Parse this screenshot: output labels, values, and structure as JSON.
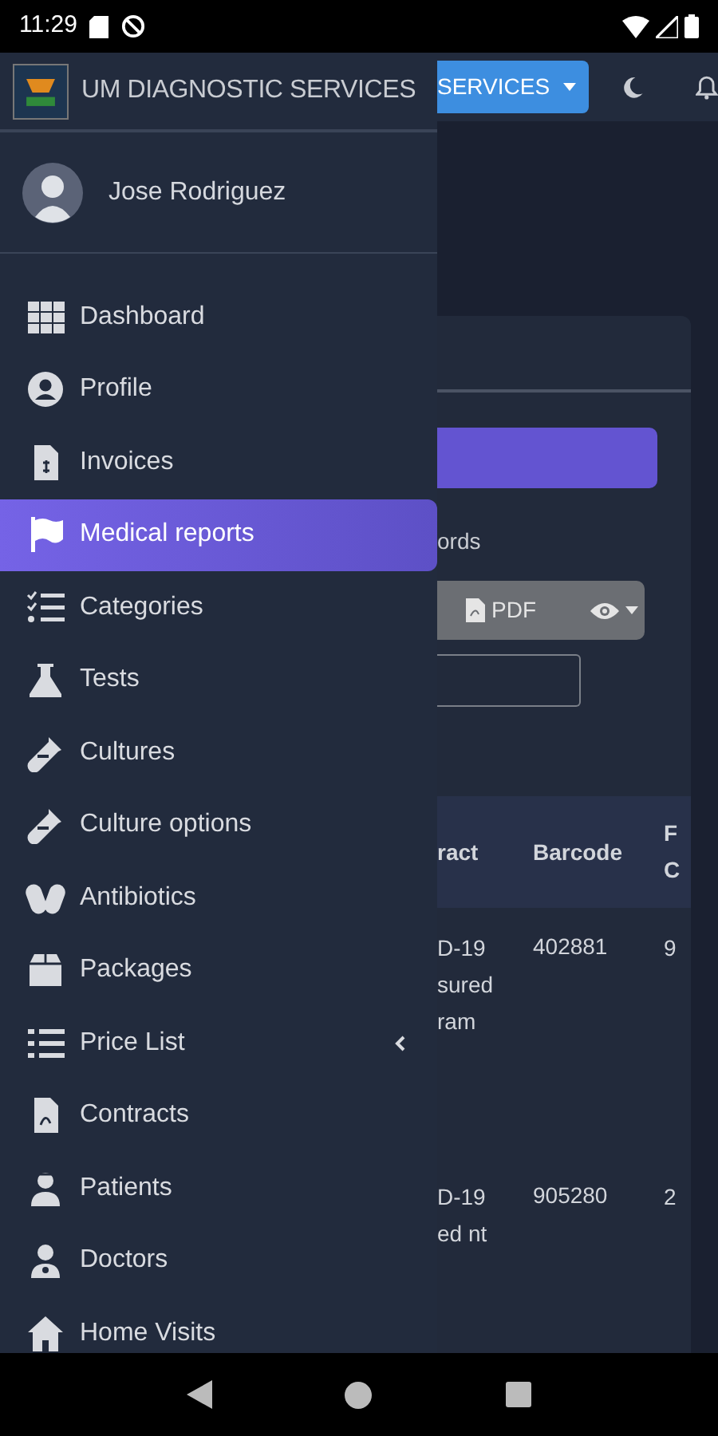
{
  "status_bar": {
    "time": "11:29"
  },
  "brand": {
    "title": "UM DIAGNOSTIC SERVICES"
  },
  "user": {
    "name": "Jose Rodriguez"
  },
  "menu": [
    {
      "label": "Dashboard",
      "selected": false
    },
    {
      "label": "Profile",
      "selected": false
    },
    {
      "label": "Invoices",
      "selected": false
    },
    {
      "label": "Medical reports",
      "selected": true
    },
    {
      "label": "Categories",
      "selected": false
    },
    {
      "label": "Tests",
      "selected": false
    },
    {
      "label": "Cultures",
      "selected": false
    },
    {
      "label": "Culture options",
      "selected": false
    },
    {
      "label": "Antibiotics",
      "selected": false
    },
    {
      "label": "Packages",
      "selected": false
    },
    {
      "label": "Price List",
      "selected": false,
      "expanded": false
    },
    {
      "label": "Contracts",
      "selected": false
    },
    {
      "label": "Patients",
      "selected": false
    },
    {
      "label": "Doctors",
      "selected": false
    },
    {
      "label": "Home Visits",
      "selected": false
    }
  ],
  "topbar": {
    "services_button": "SERVICES"
  },
  "content": {
    "caption": "ords",
    "pdf_button": "PDF",
    "table": {
      "columns": [
        "ract",
        "Barcode",
        "F C"
      ],
      "rows": [
        [
          "D-19 sured ram",
          "402881",
          "9"
        ],
        [
          "D-19 ed nt",
          "905280",
          "2"
        ]
      ]
    }
  }
}
